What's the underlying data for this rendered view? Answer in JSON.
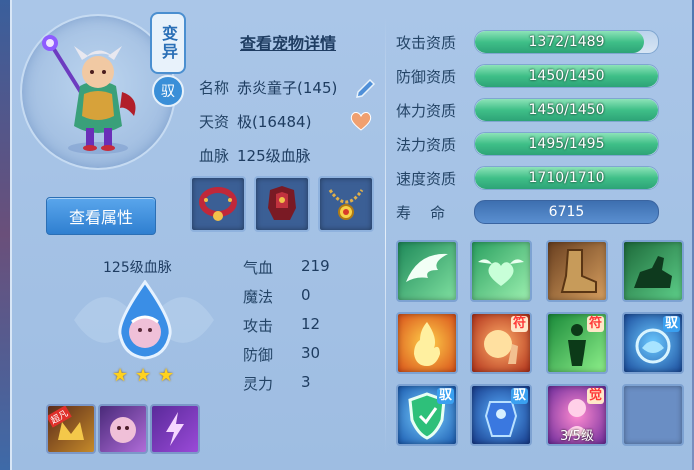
{
  "pet": {
    "mutation_badge": "变异",
    "mount_badge": "驭",
    "details_link": "查看宠物详情",
    "view_attr_button": "查看属性",
    "info": [
      {
        "label": "名称",
        "value": "赤炎童子(145)"
      },
      {
        "label": "天资",
        "value": "极(16484)"
      },
      {
        "label": "血脉",
        "value": "125级血脉"
      }
    ]
  },
  "equipment": [
    {
      "name": "collar"
    },
    {
      "name": "armor"
    },
    {
      "name": "necklace"
    }
  ],
  "bloodline": {
    "title": "125级血脉",
    "stars": 3,
    "mini_icons": [
      {
        "tag": "超凡"
      },
      {
        "tag": ""
      },
      {
        "tag": ""
      }
    ]
  },
  "attributes": [
    {
      "label": "气血",
      "value": "219"
    },
    {
      "label": "魔法",
      "value": "0"
    },
    {
      "label": "攻击",
      "value": "12"
    },
    {
      "label": "防御",
      "value": "30"
    },
    {
      "label": "灵力",
      "value": "3"
    }
  ],
  "aptitudes": [
    {
      "label": "攻击资质",
      "text": "1372/1489",
      "fill": 0.9214
    },
    {
      "label": "防御资质",
      "text": "1450/1450",
      "fill": 1.0
    },
    {
      "label": "体力资质",
      "text": "1450/1450",
      "fill": 1.0
    },
    {
      "label": "法力资质",
      "text": "1495/1495",
      "fill": 1.0
    },
    {
      "label": "速度资质",
      "text": "1710/1710",
      "fill": 1.0
    }
  ],
  "lifespan": {
    "label": "寿    命",
    "value": "6715"
  },
  "skills": [
    {
      "name": "wing-skill",
      "tag": "",
      "level": ""
    },
    {
      "name": "heart-skill",
      "tag": "",
      "level": ""
    },
    {
      "name": "boot-skill",
      "tag": "",
      "level": ""
    },
    {
      "name": "horse-skill",
      "tag": "",
      "level": ""
    },
    {
      "name": "fire-skill",
      "tag": "",
      "level": ""
    },
    {
      "name": "flame-palm-skill",
      "tag": "符",
      "level": ""
    },
    {
      "name": "silhouette-skill",
      "tag": "符",
      "level": ""
    },
    {
      "name": "ice-beast-skill",
      "tag": "驭",
      "level": ""
    },
    {
      "name": "shield-skill",
      "tag": "驭",
      "level": ""
    },
    {
      "name": "armor-spirit-skill",
      "tag": "驭",
      "level": ""
    },
    {
      "name": "awaken-skill",
      "tag": "觉",
      "level": "3/5级"
    },
    {
      "name": "empty-slot",
      "tag": "",
      "level": ""
    }
  ],
  "colors": {
    "accent_blue": "#2f7fd0",
    "bar_green": "#3fbf88",
    "tag_red": "#ff3838"
  }
}
